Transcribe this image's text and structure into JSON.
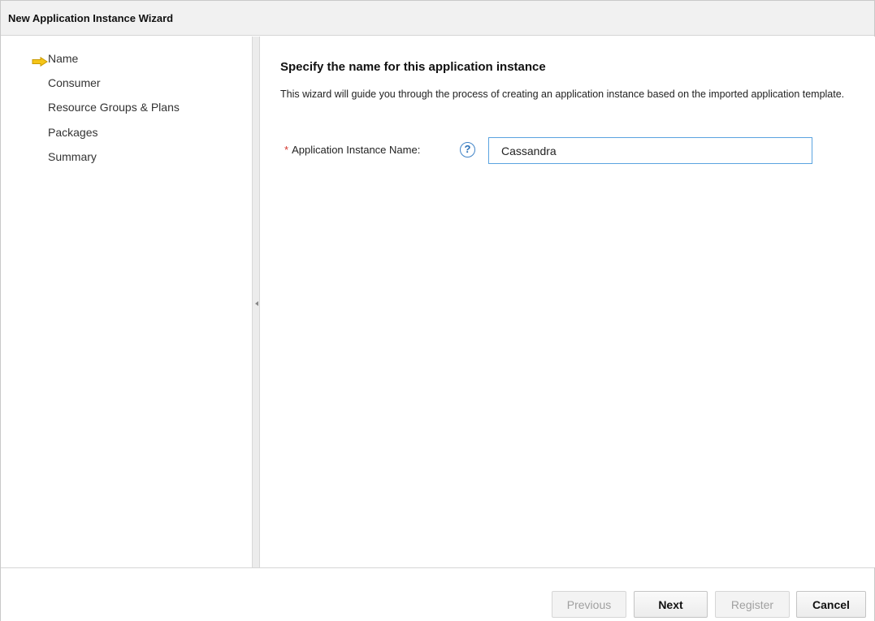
{
  "window": {
    "title": "New Application Instance Wizard"
  },
  "sidebar": {
    "current_indicator_icon": "arrow-right-icon",
    "items": [
      {
        "label": "Name",
        "current": true
      },
      {
        "label": "Consumer",
        "current": false
      },
      {
        "label": "Resource Groups & Plans",
        "current": false
      },
      {
        "label": "Packages",
        "current": false
      },
      {
        "label": "Summary",
        "current": false
      }
    ]
  },
  "main": {
    "heading": "Specify the name for this application instance",
    "description": "This wizard will guide you through the process of creating an application instance based on the imported application template.",
    "field": {
      "required_marker": "*",
      "label": "Application Instance Name:",
      "help_glyph": "?",
      "value": "Cassandra"
    }
  },
  "footer": {
    "previous_label": "Previous",
    "next_label": "Next",
    "register_label": "Register",
    "cancel_label": "Cancel"
  },
  "colors": {
    "indicator_arrow": "#f5c518",
    "required": "#d2342b",
    "help_icon": "#2a6fb6",
    "input_border": "#5aa3e0"
  }
}
